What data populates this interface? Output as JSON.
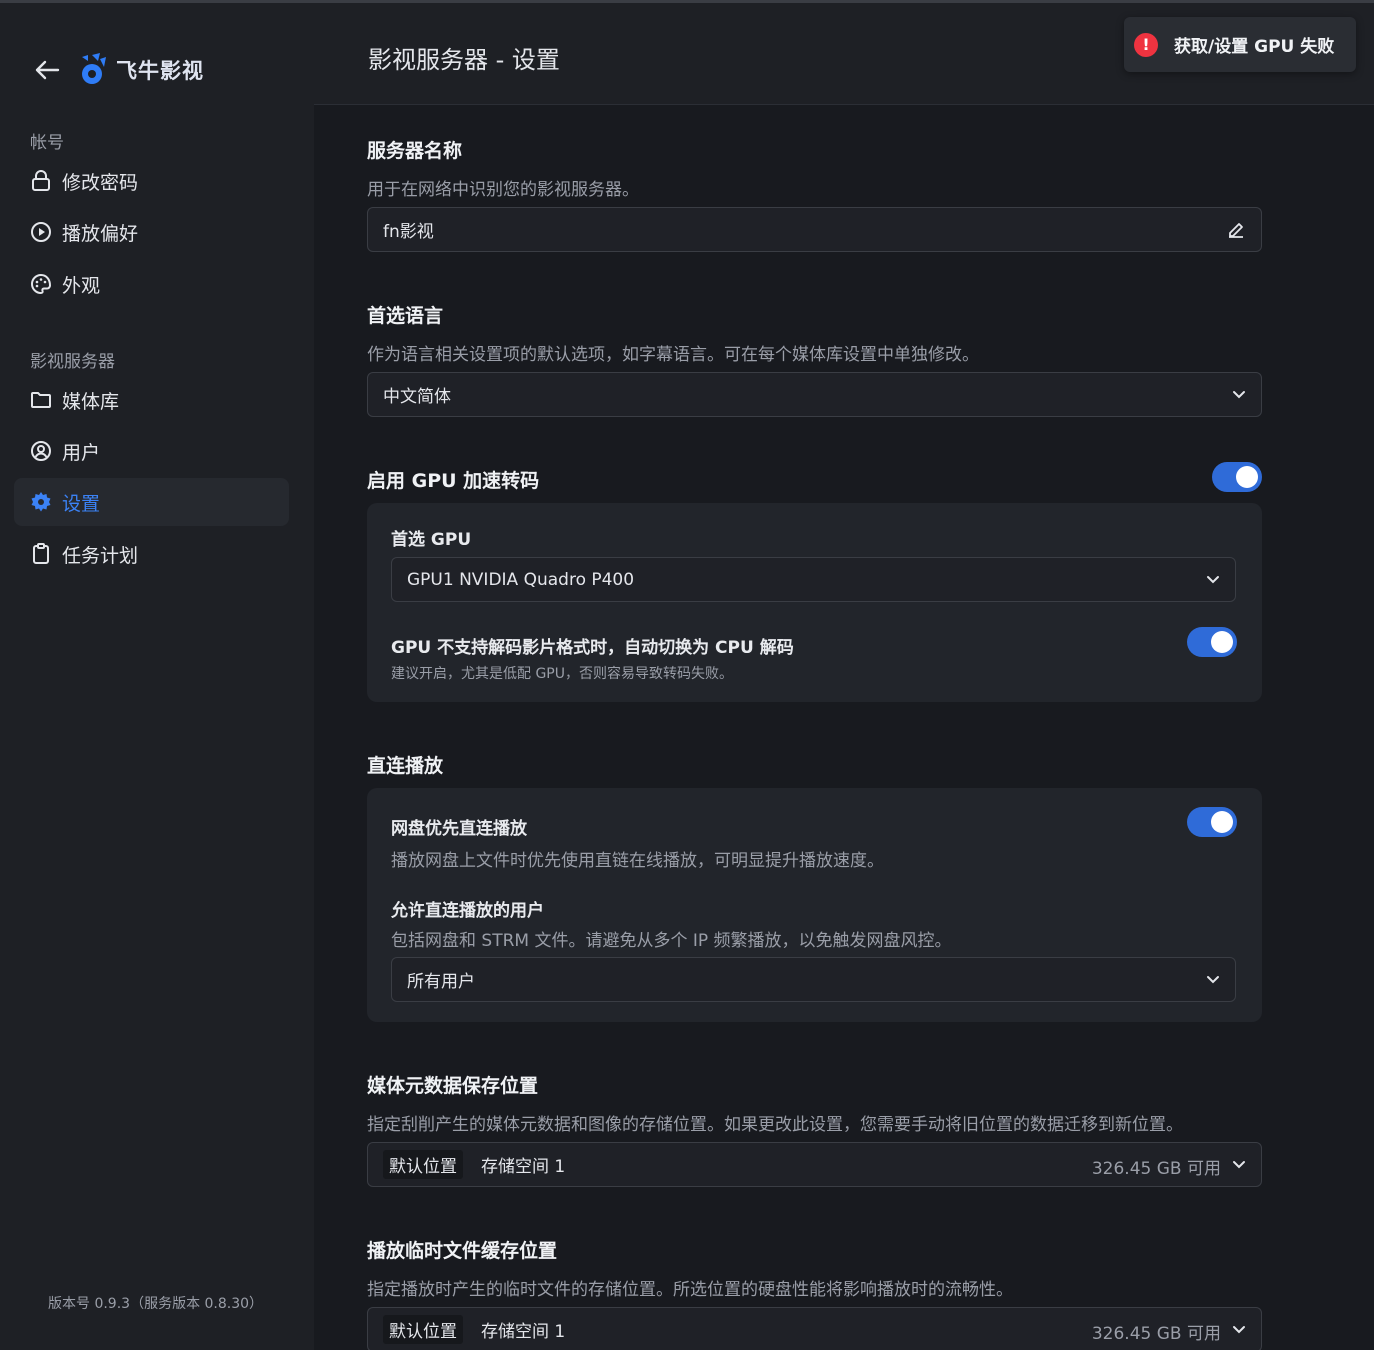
{
  "app": {
    "brand": "飞牛影视",
    "version": "版本号 0.9.3（服务版本 0.8.30）"
  },
  "sidebar": {
    "sections": [
      {
        "label": "帐号",
        "items": [
          {
            "label": "修改密码",
            "icon": "lock-icon"
          },
          {
            "label": "播放偏好",
            "icon": "play-circle-icon"
          },
          {
            "label": "外观",
            "icon": "palette-icon"
          }
        ]
      },
      {
        "label": "影视服务器",
        "items": [
          {
            "label": "媒体库",
            "icon": "folder-icon"
          },
          {
            "label": "用户",
            "icon": "user-circle-icon"
          },
          {
            "label": "设置",
            "icon": "gear-icon",
            "active": true
          },
          {
            "label": "任务计划",
            "icon": "clipboard-icon"
          }
        ]
      }
    ]
  },
  "header": {
    "title": "影视服务器 - 设置"
  },
  "toast": {
    "text": "获取/设置 GPU 失败",
    "icon": "error-icon",
    "color": "#ef3340"
  },
  "settings": {
    "server_name": {
      "title": "服务器名称",
      "desc": "用于在网络中识别您的影视服务器。",
      "value": "fn影视"
    },
    "language": {
      "title": "首选语言",
      "desc": "作为语言相关设置项的默认选项，如字幕语言。可在每个媒体库设置中单独修改。",
      "value": "中文简体"
    },
    "gpu": {
      "title": "启用 GPU 加速转码",
      "enabled": true,
      "preferred_title": "首选 GPU",
      "preferred_value": "GPU1 NVIDIA Quadro P400",
      "fallback_title": "GPU 不支持解码影片格式时，自动切换为 CPU 解码",
      "fallback_enabled": true,
      "fallback_desc": "建议开启，尤其是低配 GPU，否则容易导致转码失败。"
    },
    "direct": {
      "title": "直连播放",
      "netdisk_title": "网盘优先直连播放",
      "netdisk_enabled": true,
      "netdisk_desc": "播放网盘上文件时优先使用直链在线播放，可明显提升播放速度。",
      "users_title": "允许直连播放的用户",
      "users_desc": "包括网盘和 STRM 文件。请避免从多个 IP 频繁播放，以免触发网盘风控。",
      "users_value": "所有用户"
    },
    "metadata": {
      "title": "媒体元数据保存位置",
      "desc": "指定刮削产生的媒体元数据和图像的存储位置。如果更改此设置，您需要手动将旧位置的数据迁移到新位置。",
      "tag": "默认位置",
      "value": "存储空间 1",
      "available": "326.45 GB 可用"
    },
    "cache": {
      "title": "播放临时文件缓存位置",
      "desc": "指定播放时产生的临时文件的存储位置。所选位置的硬盘性能将影响播放时的流畅性。",
      "tag": "默认位置",
      "value": "存储空间 1",
      "available": "326.45 GB 可用"
    }
  },
  "colors": {
    "accent": "#3b82f6",
    "toggle": "#2f6bd8",
    "bg": "#181a1f",
    "sidebar": "#1e2025"
  }
}
